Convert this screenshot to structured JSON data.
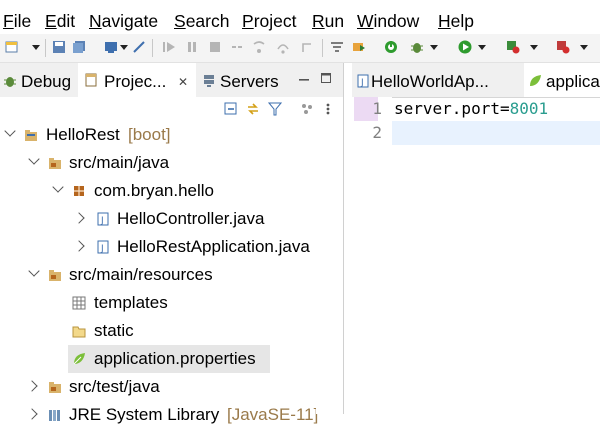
{
  "menu": [
    "File",
    "Edit",
    "Navigate",
    "Search",
    "Project",
    "Run",
    "Window",
    "Help"
  ],
  "menu_mnemonics": [
    "F",
    "E",
    "N",
    "S",
    "P",
    "R",
    "W",
    "H"
  ],
  "left_tabs": [
    {
      "label": "Debug",
      "icon": "debug-icon"
    },
    {
      "label": "Projec...",
      "icon": "project-explorer-icon",
      "close": "✕"
    },
    {
      "label": "Servers",
      "icon": "servers-icon"
    }
  ],
  "tree": [
    {
      "label": "HelloRest",
      "suffix": "[boot]",
      "icon": "project-icon",
      "state": "open",
      "level": 0
    },
    {
      "label": "src/main/java",
      "icon": "source-folder-icon",
      "state": "open",
      "level": 1
    },
    {
      "label": "com.bryan.hello",
      "icon": "package-icon",
      "state": "open",
      "level": 2
    },
    {
      "label": "HelloController.java",
      "icon": "java-file-icon",
      "state": "closed",
      "level": 3
    },
    {
      "label": "HelloRestApplication.java",
      "icon": "java-file-icon",
      "state": "closed",
      "level": 3
    },
    {
      "label": "src/main/resources",
      "icon": "source-folder-icon",
      "state": "open",
      "level": 1
    },
    {
      "label": "templates",
      "icon": "folder-grid-icon",
      "state": "none",
      "level": 2
    },
    {
      "label": "static",
      "icon": "folder-icon",
      "state": "none",
      "level": 2
    },
    {
      "label": "application.properties",
      "icon": "spring-leaf-icon",
      "state": "none",
      "level": 2,
      "selected": true
    },
    {
      "label": "src/test/java",
      "icon": "source-folder-icon",
      "state": "closed",
      "level": 1
    },
    {
      "label": "JRE System Library",
      "suffix": "[JavaSE-11]",
      "icon": "library-icon",
      "state": "closed",
      "level": 1
    }
  ],
  "editor_tabs": [
    {
      "label": "HelloWorldAp...",
      "icon": "java-file-icon"
    },
    {
      "label": "applica",
      "icon": "spring-leaf-icon"
    }
  ],
  "editor_lines": [
    {
      "number": "1",
      "key": "server.port=",
      "value": "8001"
    },
    {
      "number": "2",
      "key": "",
      "value": ""
    }
  ],
  "colors": {
    "value": "#2a9d8f",
    "selection": "#e6e6e6",
    "current_line": "#e8f2fe"
  }
}
